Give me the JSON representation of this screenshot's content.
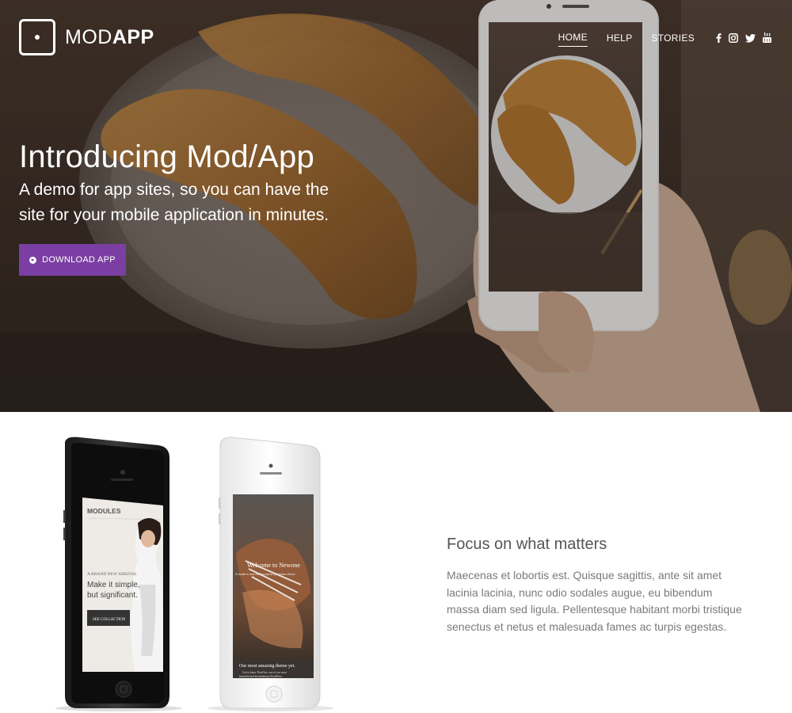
{
  "brand": {
    "logo_light": "MOD",
    "logo_bold": "APP"
  },
  "nav": {
    "items": [
      {
        "label": "HOME",
        "active": true
      },
      {
        "label": "HELP",
        "active": false
      },
      {
        "label": "STORIES",
        "active": false
      }
    ],
    "social": [
      "facebook-icon",
      "instagram-icon",
      "twitter-icon",
      "youtube-icon"
    ]
  },
  "hero": {
    "title": "Introducing Mod/App",
    "subtitle": "A demo for app sites, so you can have the site for your mobile application in minutes.",
    "button_label": "DOWNLOAD APP"
  },
  "phone_screens": {
    "left": {
      "header": "MODULES",
      "eyebrow": "A BRAND NEW ARRIVAL",
      "headline": "Make it simple, but significant.",
      "button": "SEE COLLECTION"
    },
    "right": {
      "title": "Welcome to Newone",
      "tagline": "A modern and multipurpose premium theme.",
      "caption": "Our most amazing theme yet.",
      "body": "Get to know NewOne, one of our most beautiful and breathtaking WordPress"
    }
  },
  "feature": {
    "heading": "Focus on what matters",
    "body": "Maecenas et lobortis est. Quisque sagittis, ante sit amet lacinia lacinia, nunc odio sodales augue, eu bibendum massa diam sed ligula. Pellentesque habitant morbi tristique senectus et netus et malesuada fames ac turpis egestas."
  },
  "colors": {
    "accent": "#7b3fa3",
    "hero_bg": "#3d3129",
    "body_text": "#7a7a7a",
    "heading_text": "#555555"
  }
}
